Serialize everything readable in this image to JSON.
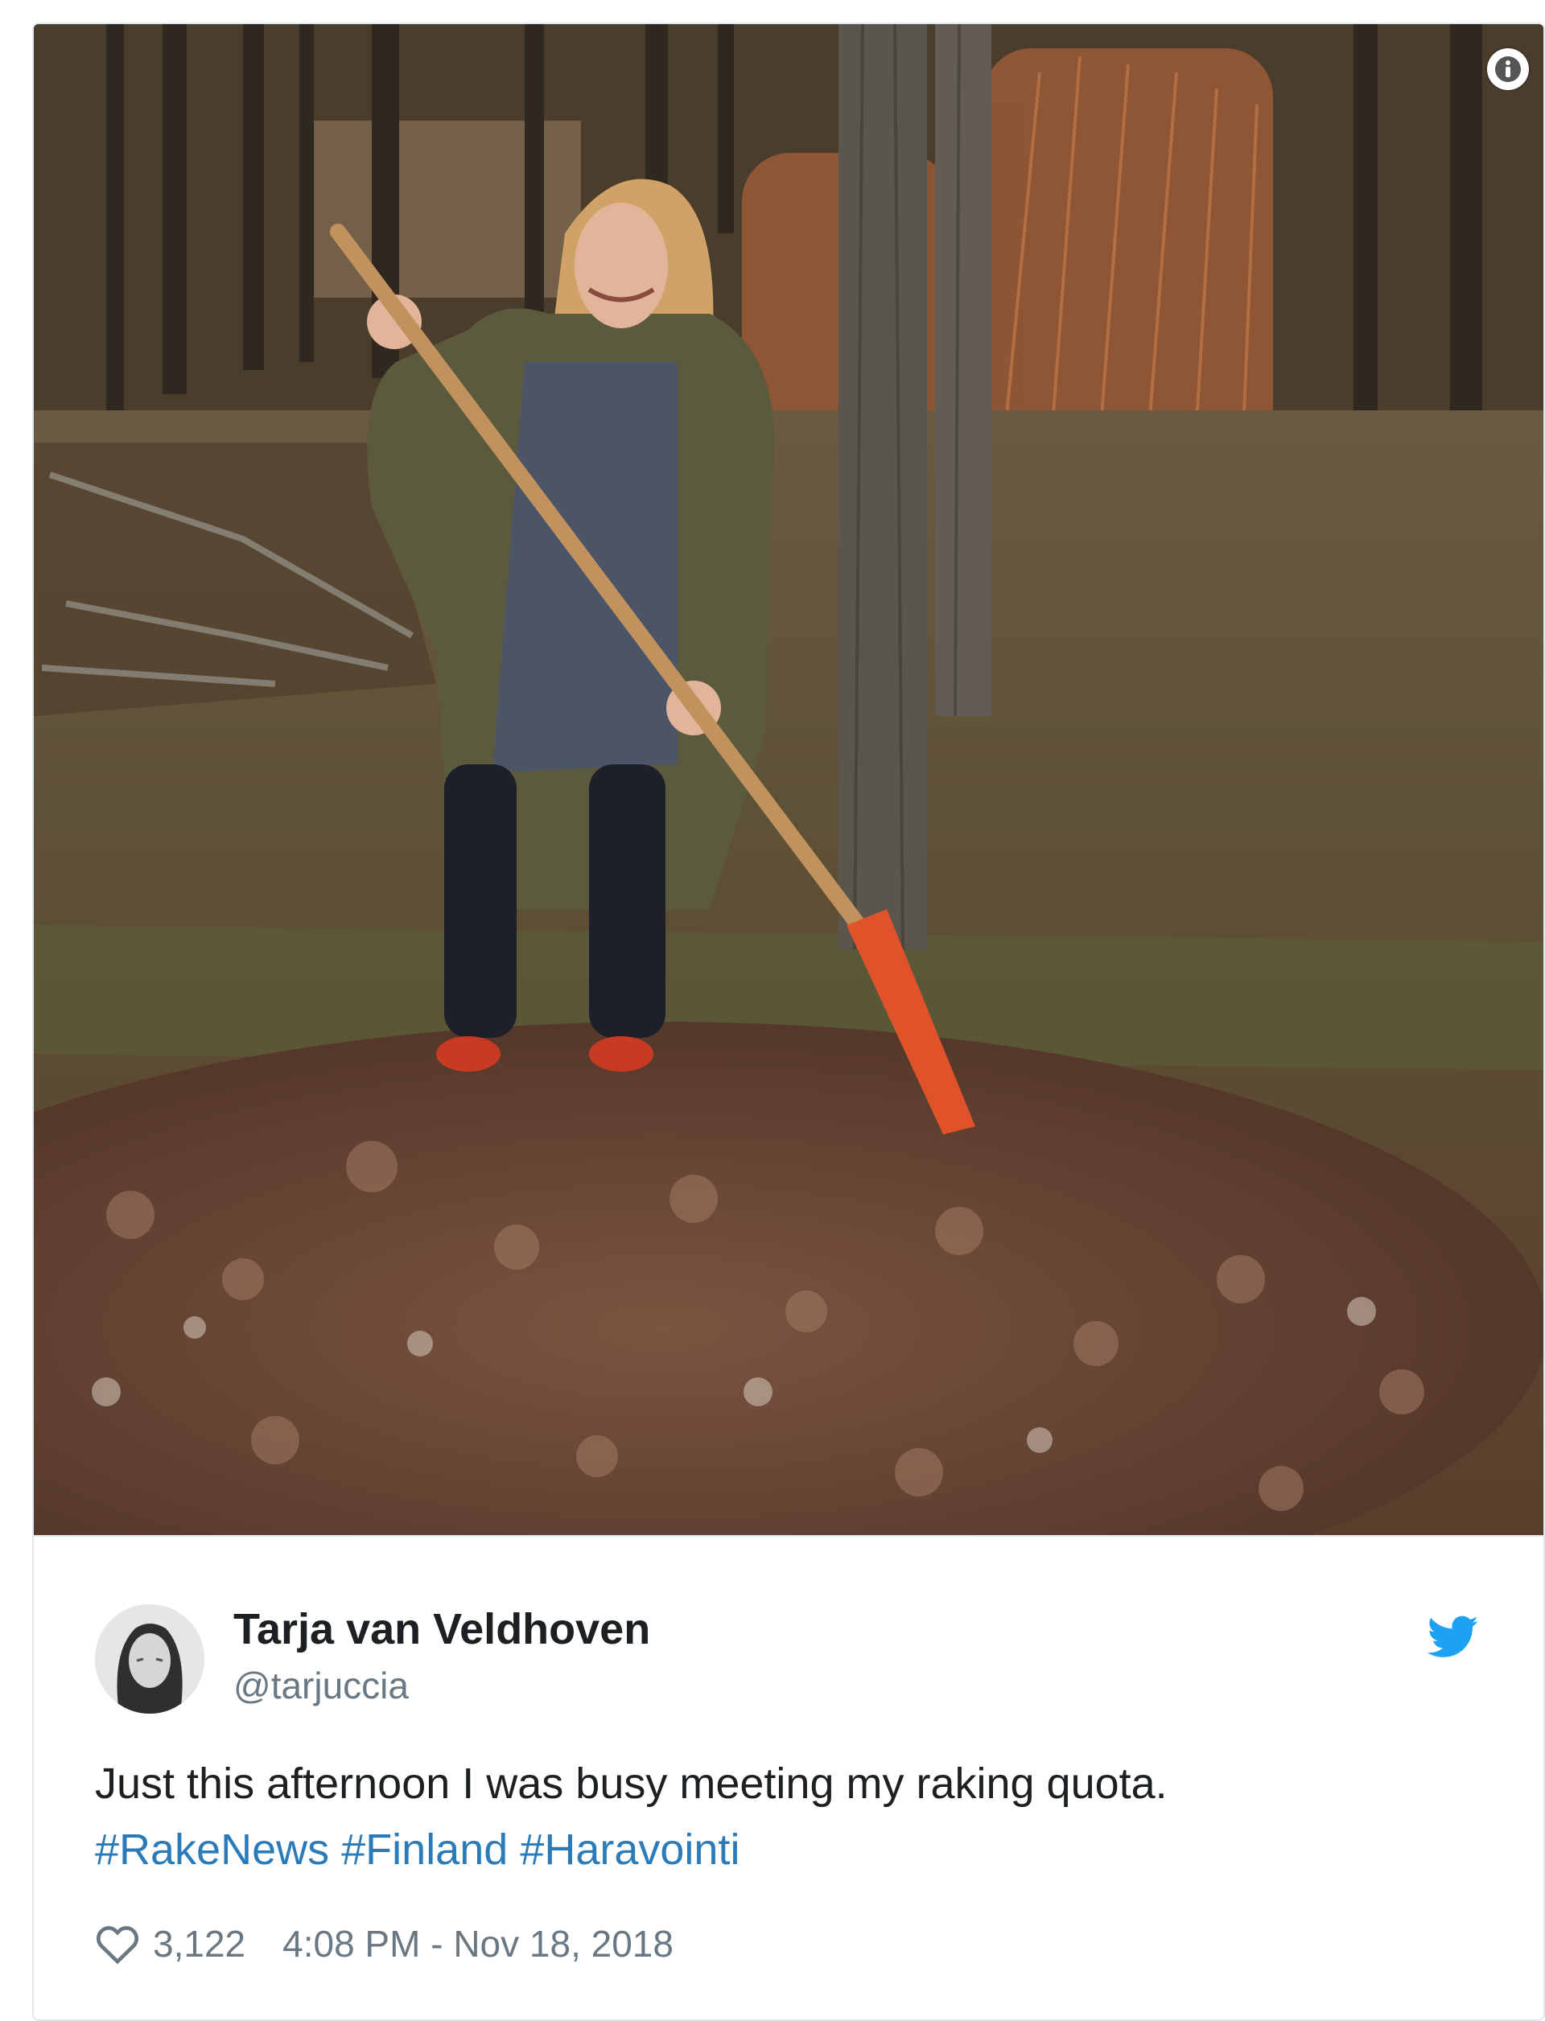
{
  "media": {
    "alt": "",
    "info_icon": "info-circle-icon"
  },
  "author": {
    "display_name": "Tarja van Veldhoven",
    "handle": "@tarjuccia",
    "avatar_icon": "avatar"
  },
  "brand": {
    "logo_icon": "twitter-bird-icon",
    "color": "#1da1f2"
  },
  "tweet": {
    "text": "Just this afternoon I was busy meeting my raking quota.",
    "hashtags": [
      "#RakeNews",
      "#Finland",
      "#Haravointi"
    ],
    "link_color": "#2b7bb9"
  },
  "footer": {
    "like_icon": "heart-icon",
    "likes": "3,122",
    "timestamp": "4:08 PM - Nov 18, 2018"
  }
}
